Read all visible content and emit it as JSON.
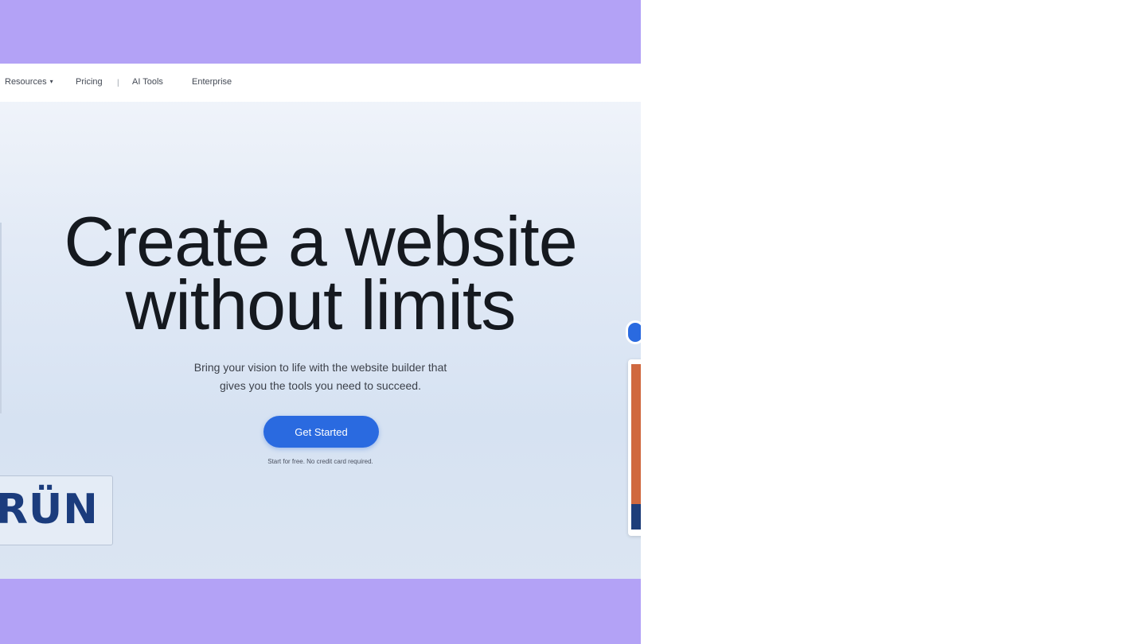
{
  "nav": {
    "items": [
      {
        "label": "Resources",
        "has_dropdown": true
      },
      {
        "label": "Pricing"
      },
      {
        "label": "AI Tools"
      },
      {
        "label": "Enterprise"
      }
    ],
    "separator": "|"
  },
  "hero": {
    "title_line1": "Create a website",
    "title_line2": "without limits",
    "subtitle_line1": "Bring your vision to life with the website builder that",
    "subtitle_line2": "gives you the tools you need to succeed.",
    "cta_label": "Get Started",
    "cta_note": "Start for free. No credit card required."
  },
  "overlay_logo": {
    "text": "RÜN"
  },
  "colors": {
    "frame": "#b3a2f6",
    "accent": "#2a6ae0",
    "logo": "#1b3c7d",
    "title": "#15191f"
  },
  "icons": {
    "dropdown": "chevron-down-icon"
  }
}
